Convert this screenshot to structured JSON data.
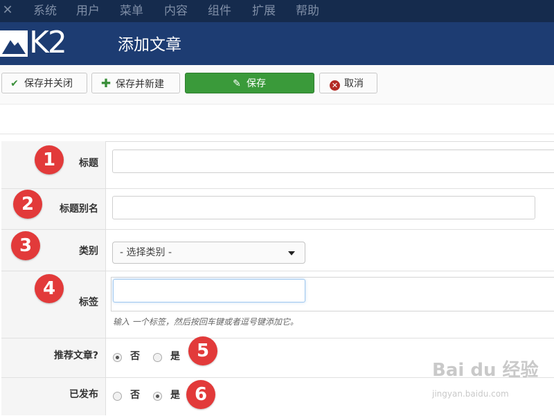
{
  "menubar": {
    "logo_icon": "joomla-icon",
    "items": [
      "系统",
      "用户",
      "菜单",
      "内容",
      "组件",
      "扩展",
      "帮助"
    ]
  },
  "header": {
    "brand_text": "K2",
    "title": "添加文章"
  },
  "toolbar": {
    "save_close": "保存并关闭",
    "save_new": "保存并新建",
    "save": "保存",
    "cancel": "取消",
    "save_close_icon": "check-icon",
    "save_new_icon": "plus-icon",
    "save_icon": "edit-icon",
    "cancel_icon": "close-circle-icon",
    "primary_color": "#3a9a3a"
  },
  "form": {
    "title_label": "标题",
    "alias_label": "标题别名",
    "category_label": "类别",
    "category_value": "- 选择类别 -",
    "tags_label": "标签",
    "tags_hint": "输入 一个标签，然后按回车键或者逗号键添加它。",
    "featured_label": "推荐文章?",
    "featured_options": [
      "否",
      "是"
    ],
    "featured_selected": "否",
    "published_label": "已发布",
    "published_options": [
      "否",
      "是"
    ],
    "published_selected": "是"
  },
  "annotations": [
    "1",
    "2",
    "3",
    "4",
    "5",
    "6"
  ],
  "annotation_color": "#e23a3a",
  "watermark": {
    "text": "Bai du 经验",
    "url": "jingyan.baidu.com"
  }
}
